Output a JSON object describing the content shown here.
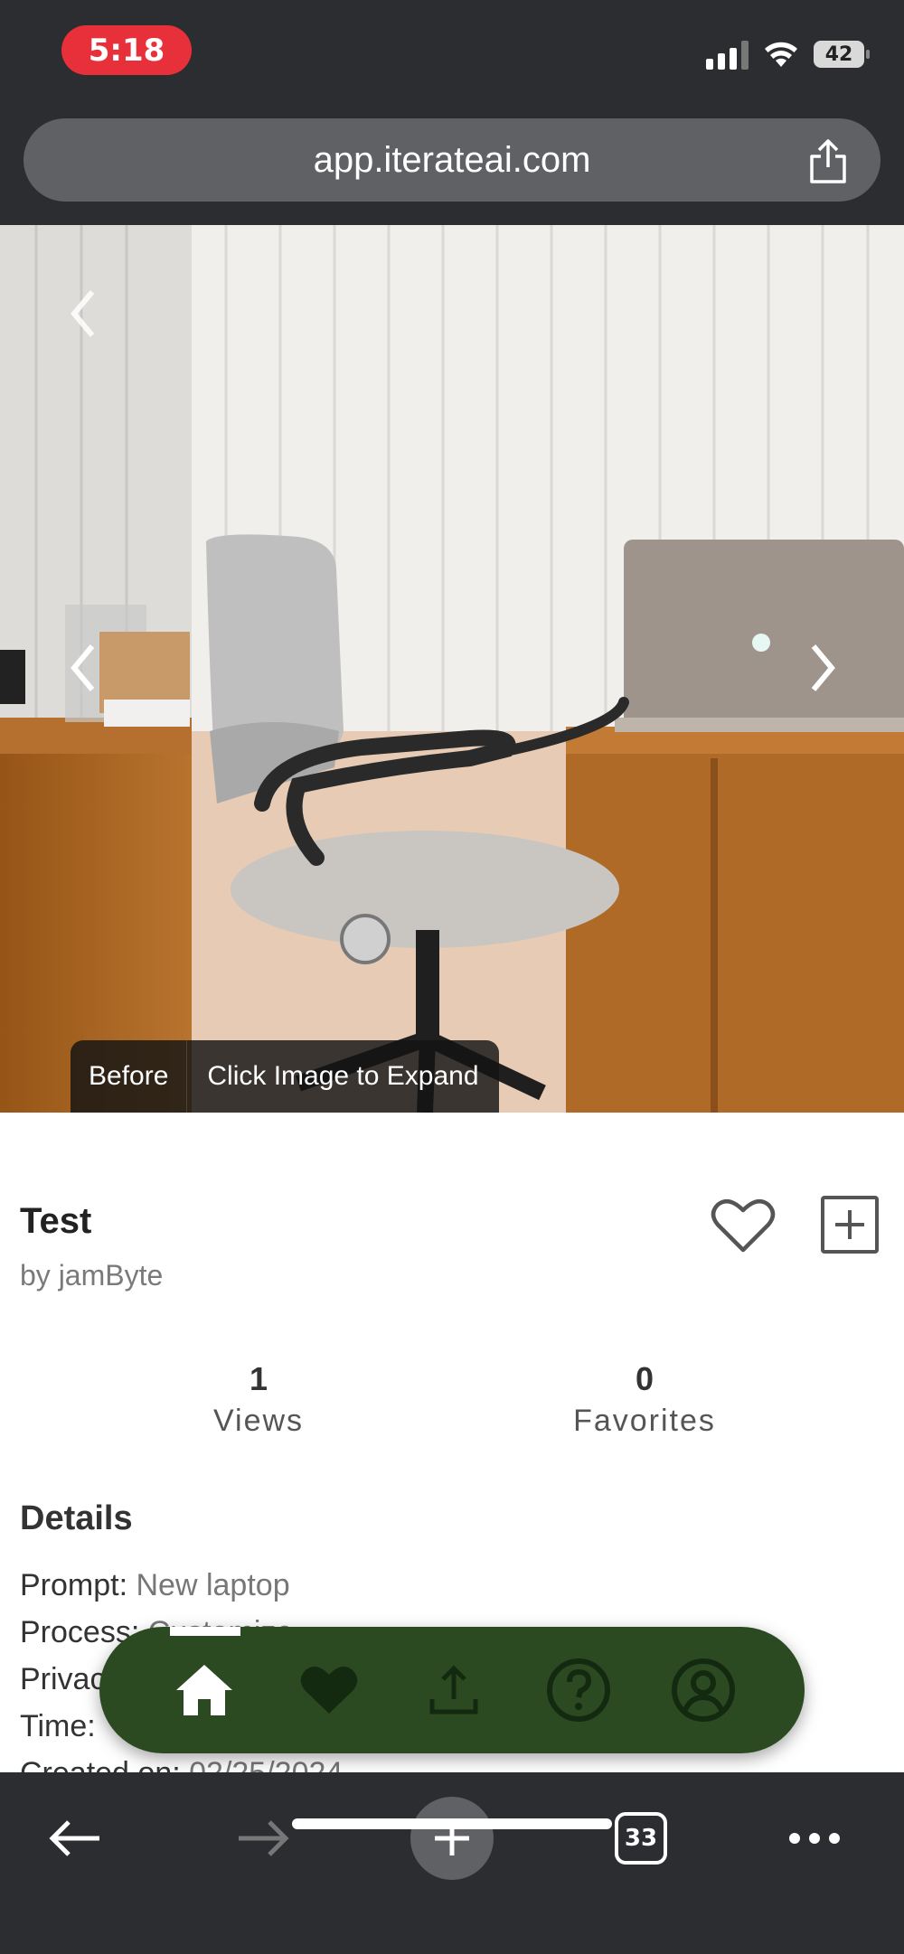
{
  "status_bar": {
    "time": "5:18",
    "battery": "42"
  },
  "browser": {
    "url": "app.iterateai.com",
    "tabs_count": "33"
  },
  "hero": {
    "caption_before": "Before",
    "caption_expand": "Click Image to Expand"
  },
  "item": {
    "title": "Test",
    "author": "by jamByte"
  },
  "stats": [
    {
      "value": "1",
      "label": "Views"
    },
    {
      "value": "0",
      "label": "Favorites"
    }
  ],
  "details": {
    "heading": "Details",
    "rows": [
      {
        "key": "Prompt:",
        "value": "New laptop"
      },
      {
        "key": "Process:",
        "value": "Customize"
      },
      {
        "key": "Privacy:",
        "value": ""
      },
      {
        "key": "Time:",
        "value": ""
      },
      {
        "key": "Created on:",
        "value": "02/25/2024"
      }
    ]
  },
  "float_nav": {
    "items": [
      "home-icon",
      "heart-icon",
      "upload-icon",
      "help-icon",
      "profile-icon"
    ],
    "active": "home-icon",
    "color": "#2c4a22"
  }
}
